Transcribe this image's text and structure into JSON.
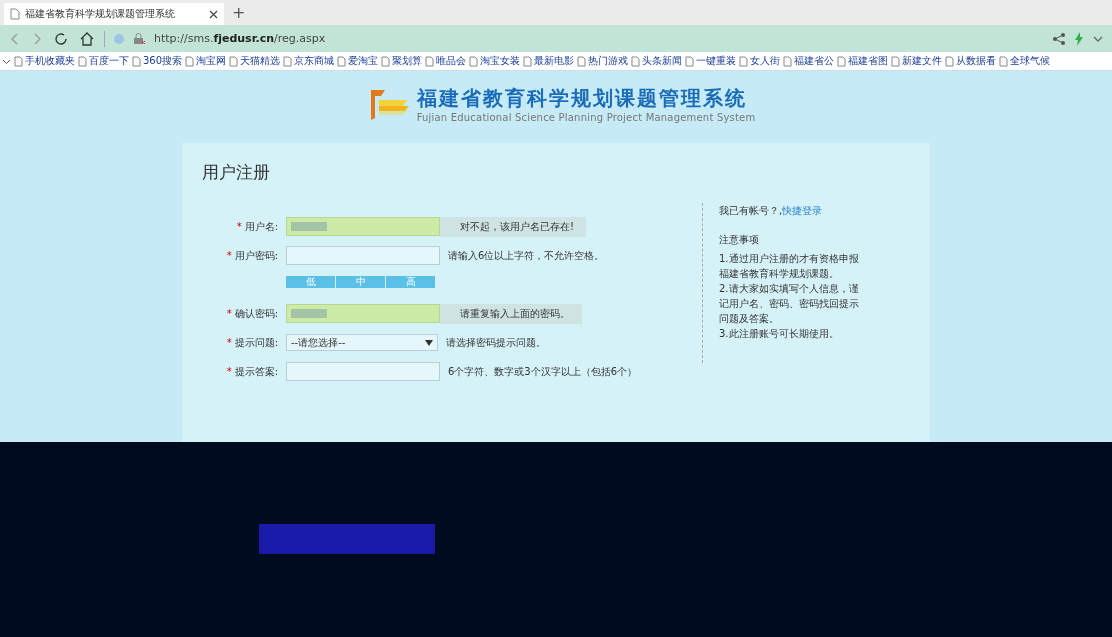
{
  "browser": {
    "tabs": [
      {
        "title": "福建省教育科学规划课题管理系统",
        "selected": true
      }
    ],
    "new_tab": "+",
    "url": {
      "host_prefix": "http://sms.",
      "host": "fjedusr.cn",
      "path": "/reg.aspx"
    },
    "bookmarks": [
      "手机收藏夹",
      "百度一下",
      "360搜索",
      "淘宝网",
      "天猫精选",
      "京东商城",
      "爱淘宝",
      "聚划算",
      "唯品会",
      "淘宝女装",
      "最新电影",
      "热门游戏",
      "头条新闻",
      "一键重装",
      "女人街",
      "福建省公",
      "福建省图",
      "新建文件",
      "从数据看",
      "全球气候"
    ]
  },
  "site": {
    "title": "福建省教育科学规划课题管理系统",
    "subtitle": "Fujian Educational Science Planning Project Management System"
  },
  "form": {
    "heading": "用户注册",
    "required_mark": "*",
    "rows": [
      {
        "kind": "input",
        "label": "用户名:",
        "required": true,
        "filled": true,
        "hint": "对不起，该用户名已存在!",
        "hint_boxed": true
      },
      {
        "kind": "input",
        "label": "用户密码:",
        "required": true,
        "filled": false,
        "hint": "请输入6位以上字符，不允许空格。",
        "hint_boxed": false
      },
      {
        "kind": "strength",
        "levels": [
          "低",
          "中",
          "高"
        ]
      },
      {
        "kind": "input",
        "label": "确认密码:",
        "required": true,
        "filled": true,
        "hint": "请重复输入上面的密码。",
        "hint_boxed": true
      },
      {
        "kind": "select",
        "label": "提示问题:",
        "required": true,
        "value": "--请您选择--",
        "hint": "请选择密码提示问题。"
      },
      {
        "kind": "input",
        "label": "提示答案:",
        "required": true,
        "filled": false,
        "hint": "6个字符、数字或3个汉字以上（包括6个）",
        "hint_boxed": false
      }
    ]
  },
  "sidebar": {
    "prompt": "我已有帐号？,",
    "login_link": "快捷登录",
    "notes_title": "注意事项",
    "notes": [
      "1.通过用户注册的才有资格申报福建省教育科学规划课题。",
      "2.请大家如实填写个人信息，谨记用户名、密码、密码找回提示问题及答案。",
      "3.此注册账号可长期使用。"
    ]
  }
}
